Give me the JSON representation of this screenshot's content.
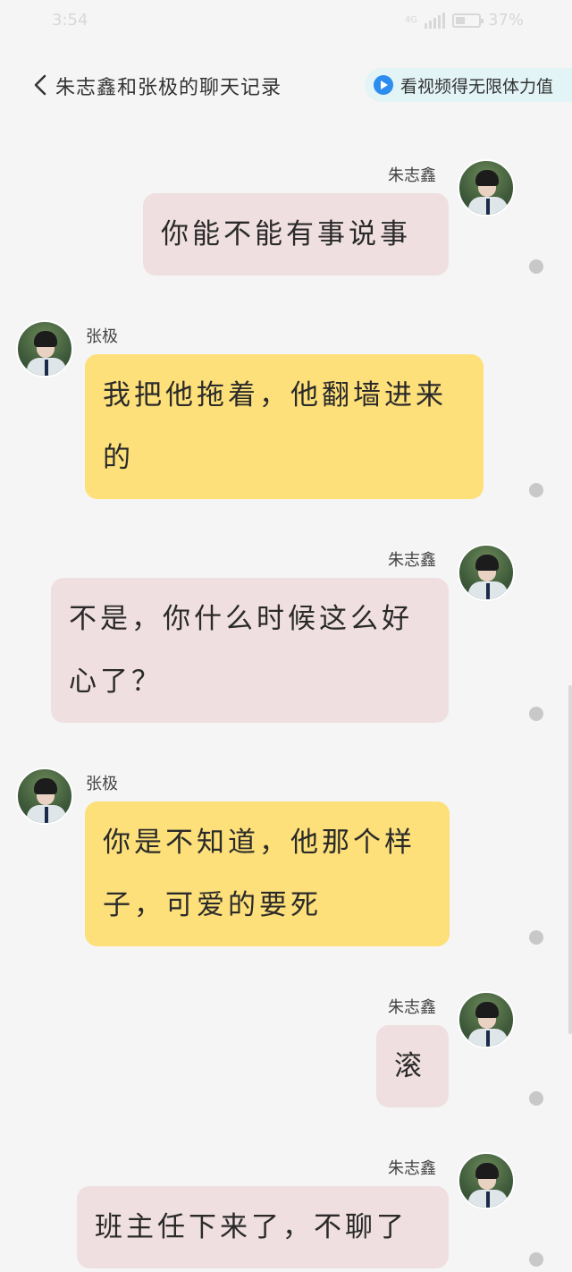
{
  "status_bar": {
    "time": "3:54",
    "network": "4G",
    "battery": "37%"
  },
  "header": {
    "title": "朱志鑫和张极的聊天记录",
    "video_button": "看视频得无限体力值"
  },
  "messages": [
    {
      "sender": "朱志鑫",
      "side": "right",
      "color": "pink",
      "text": "你能不能有事说事"
    },
    {
      "sender": "张极",
      "side": "left",
      "color": "yellow",
      "lines": [
        "我把他拖着，他翻墙进来",
        "的"
      ]
    },
    {
      "sender": "朱志鑫",
      "side": "right",
      "color": "pink",
      "lines": [
        "不是，你什么时候这么好",
        "心了？"
      ]
    },
    {
      "sender": "张极",
      "side": "left",
      "color": "yellow",
      "lines": [
        "你是不知道，他那个样",
        "子，可爱的要死"
      ]
    },
    {
      "sender": "朱志鑫",
      "side": "right",
      "color": "pink",
      "text": "滚"
    },
    {
      "sender": "朱志鑫",
      "side": "right",
      "color": "pink",
      "text": "班主任下来了，不聊了"
    }
  ],
  "colors": {
    "pink_bubble": "#f0dfe0",
    "yellow_bubble": "#fde07a",
    "accent": "#2d8cf0"
  }
}
